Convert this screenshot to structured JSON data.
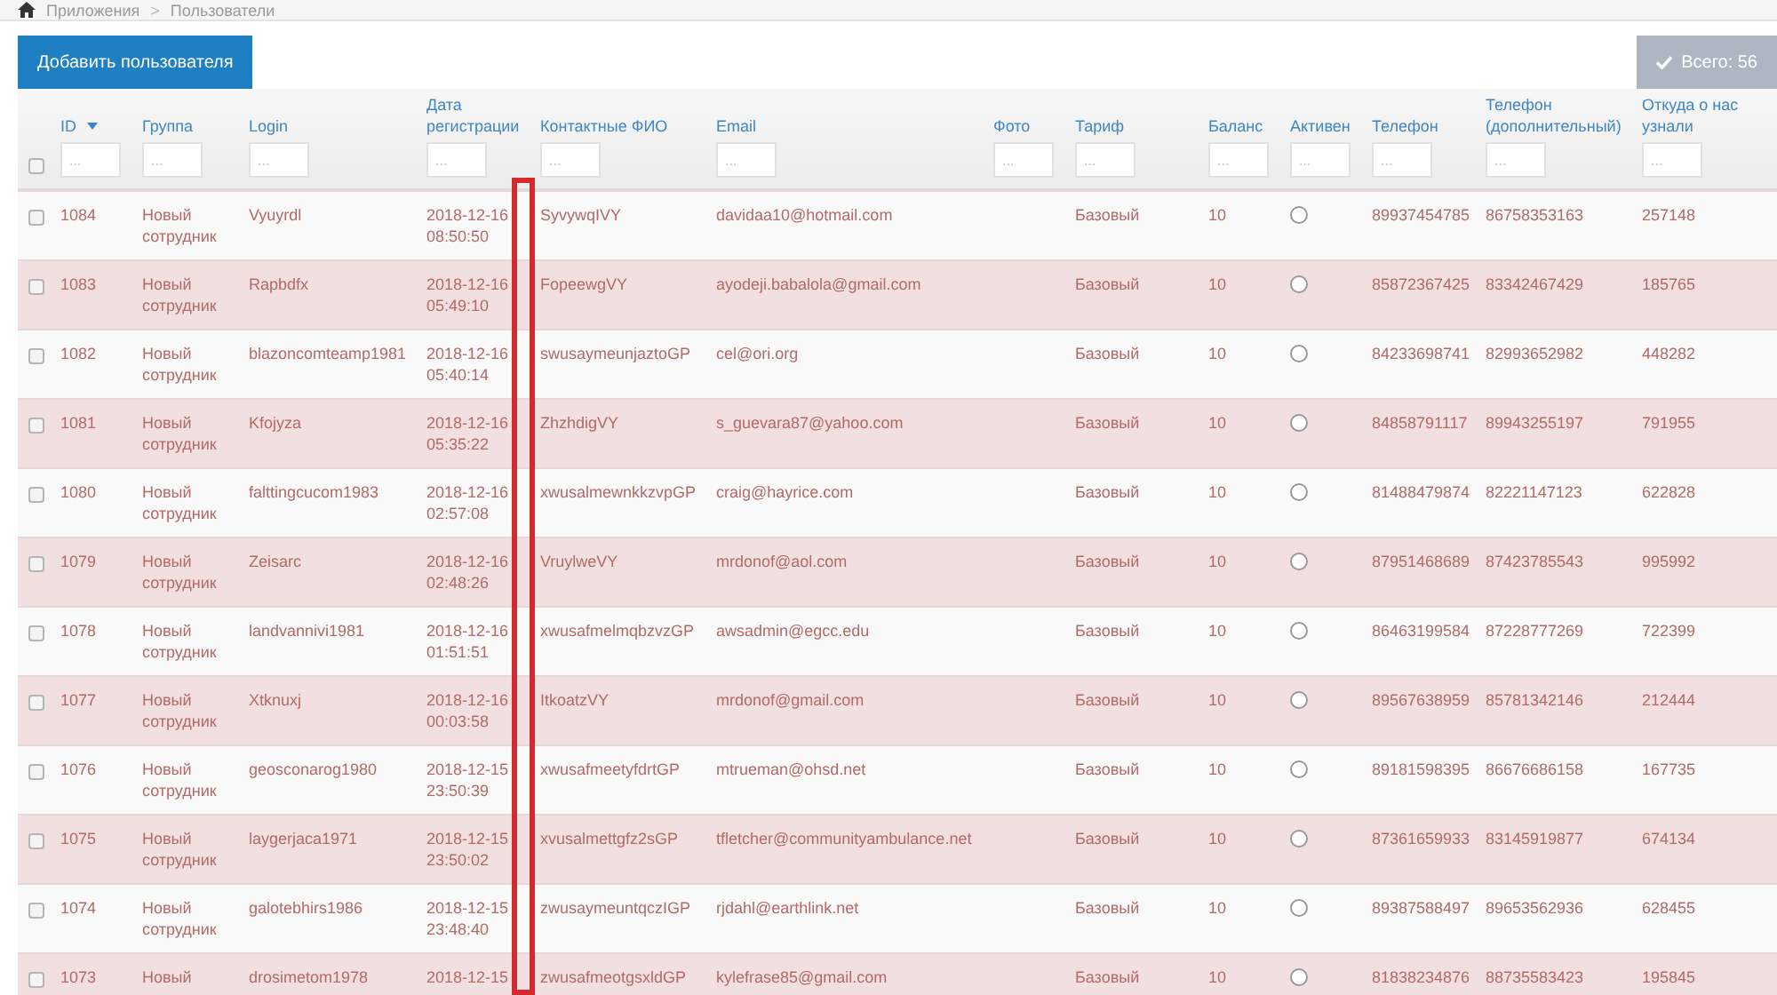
{
  "breadcrumb": {
    "items": [
      "Приложения",
      "Пользователи"
    ],
    "separator": ">"
  },
  "add_button": "Добавить пользователя",
  "total_button": {
    "label": "Всего: 56",
    "disabled": true
  },
  "table": {
    "select_all": {
      "checked": false
    },
    "columns": [
      {
        "label": "ID",
        "sorted": true,
        "placeholder": "..."
      },
      {
        "label": "Группа",
        "sorted": false,
        "placeholder": "..."
      },
      {
        "label": "Login",
        "sorted": false,
        "placeholder": "..."
      },
      {
        "label": "Дата регистрации",
        "sorted": false,
        "placeholder": "..."
      },
      {
        "label": "Контактные ФИО",
        "sorted": false,
        "placeholder": "..."
      },
      {
        "label": "Email",
        "sorted": false,
        "placeholder": "..."
      },
      {
        "label": "Фото",
        "sorted": false,
        "placeholder": "..."
      },
      {
        "label": "Тариф",
        "sorted": false,
        "placeholder": "..."
      },
      {
        "label": "Баланс",
        "sorted": false,
        "placeholder": "..."
      },
      {
        "label": "Активен",
        "sorted": false,
        "placeholder": "..."
      },
      {
        "label": "Телефон",
        "sorted": false,
        "placeholder": "..."
      },
      {
        "label": "Телефон (дополнительный)",
        "sorted": false,
        "placeholder": "..."
      },
      {
        "label": "Откуда о нас узнали",
        "sorted": false,
        "placeholder": "..."
      }
    ],
    "rows": [
      {
        "checked": false,
        "id": "1084",
        "group": "Новый сотрудник",
        "login": "Vyuyrdl",
        "registered": "2018-12-16 08:50:50",
        "name": "SyvywqIVY",
        "email": "davidaa10@hotmail.com",
        "tariff": "Базовый",
        "balance": "10",
        "active": false,
        "phone": "89937454785",
        "phone2": "86758353163",
        "source": "257148"
      },
      {
        "checked": false,
        "id": "1083",
        "group": "Новый сотрудник",
        "login": "Rapbdfx",
        "registered": "2018-12-16 05:49:10",
        "name": "FopeewgVY",
        "email": "ayodeji.babalola@gmail.com",
        "tariff": "Базовый",
        "balance": "10",
        "active": false,
        "phone": "85872367425",
        "phone2": "83342467429",
        "source": "185765"
      },
      {
        "checked": false,
        "id": "1082",
        "group": "Новый сотрудник",
        "login": "blazoncomteamp1981",
        "registered": "2018-12-16 05:40:14",
        "name": "swusaymeunjaztoGP",
        "email": "cel@ori.org",
        "tariff": "Базовый",
        "balance": "10",
        "active": false,
        "phone": "84233698741",
        "phone2": "82993652982",
        "source": "448282"
      },
      {
        "checked": false,
        "id": "1081",
        "group": "Новый сотрудник",
        "login": "Kfojyza",
        "registered": "2018-12-16 05:35:22",
        "name": "ZhzhdigVY",
        "email": "s_guevara87@yahoo.com",
        "tariff": "Базовый",
        "balance": "10",
        "active": false,
        "phone": "84858791117",
        "phone2": "89943255197",
        "source": "791955"
      },
      {
        "checked": false,
        "id": "1080",
        "group": "Новый сотрудник",
        "login": "falttingcucom1983",
        "registered": "2018-12-16 02:57:08",
        "name": "xwusalmewnkkzvpGP",
        "email": "craig@hayrice.com",
        "tariff": "Базовый",
        "balance": "10",
        "active": false,
        "phone": "81488479874",
        "phone2": "82221147123",
        "source": "622828"
      },
      {
        "checked": false,
        "id": "1079",
        "group": "Новый сотрудник",
        "login": "Zeisarc",
        "registered": "2018-12-16 02:48:26",
        "name": "VruylweVY",
        "email": "mrdonof@aol.com",
        "tariff": "Базовый",
        "balance": "10",
        "active": false,
        "phone": "87951468689",
        "phone2": "87423785543",
        "source": "995992"
      },
      {
        "checked": false,
        "id": "1078",
        "group": "Новый сотрудник",
        "login": "landvannivi1981",
        "registered": "2018-12-16 01:51:51",
        "name": "xwusafmelmqbzvzGP",
        "email": "awsadmin@egcc.edu",
        "tariff": "Базовый",
        "balance": "10",
        "active": false,
        "phone": "86463199584",
        "phone2": "87228777269",
        "source": "722399"
      },
      {
        "checked": false,
        "id": "1077",
        "group": "Новый сотрудник",
        "login": "Xtknuxj",
        "registered": "2018-12-16 00:03:58",
        "name": "ItkoatzVY",
        "email": "mrdonof@gmail.com",
        "tariff": "Базовый",
        "balance": "10",
        "active": false,
        "phone": "89567638959",
        "phone2": "85781342146",
        "source": "212444"
      },
      {
        "checked": false,
        "id": "1076",
        "group": "Новый сотрудник",
        "login": "geosconarog1980",
        "registered": "2018-12-15 23:50:39",
        "name": "xwusafmeetyfdrtGP",
        "email": "mtrueman@ohsd.net",
        "tariff": "Базовый",
        "balance": "10",
        "active": false,
        "phone": "89181598395",
        "phone2": "86676686158",
        "source": "167735"
      },
      {
        "checked": false,
        "id": "1075",
        "group": "Новый сотрудник",
        "login": "laygerjaca1971",
        "registered": "2018-12-15 23:50:02",
        "name": "xvusalmettgfz2sGP",
        "email": "tfletcher@communityambulance.net",
        "tariff": "Базовый",
        "balance": "10",
        "active": false,
        "phone": "87361659933",
        "phone2": "83145919877",
        "source": "674134"
      },
      {
        "checked": false,
        "id": "1074",
        "group": "Новый сотрудник",
        "login": "galotebhirs1986",
        "registered": "2018-12-15 23:48:40",
        "name": "zwusaymeuntqczIGP",
        "email": "rjdahl@earthlink.net",
        "tariff": "Базовый",
        "balance": "10",
        "active": false,
        "phone": "89387588497",
        "phone2": "89653562936",
        "source": "628455"
      },
      {
        "checked": false,
        "id": "1073",
        "group": "Новый",
        "login": "drosimetom1978",
        "registered": "2018-12-15",
        "name": "zwusafmeotgsxldGP",
        "email": "kylefrase85@gmail.com",
        "tariff": "Базовый",
        "balance": "10",
        "active": false,
        "phone": "81838234876",
        "phone2": "88735583423",
        "source": "195845"
      }
    ]
  }
}
